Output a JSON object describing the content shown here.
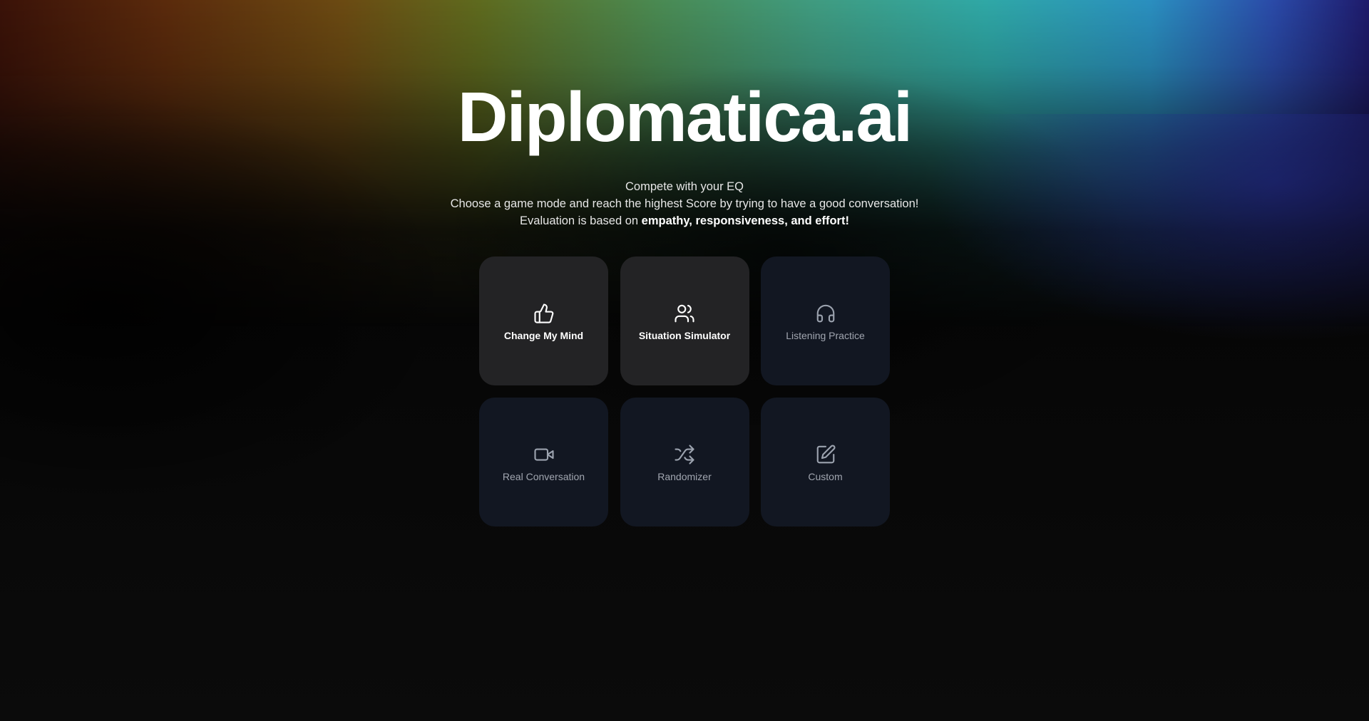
{
  "header": {
    "title": "Diplomatica.ai"
  },
  "intro": {
    "line1": "Compete with your EQ",
    "line2": "Choose a game mode and reach the highest Score by trying to have a good conversation!",
    "line3_prefix": "Evaluation is based on ",
    "line3_bold": "empathy, responsiveness, and effort!"
  },
  "modes": [
    {
      "label": "Change My Mind",
      "icon": "thumbs-up-icon",
      "state": "active"
    },
    {
      "label": "Situation Simulator",
      "icon": "users-icon",
      "state": "active"
    },
    {
      "label": "Listening Practice",
      "icon": "headphones-icon",
      "state": "inactive"
    },
    {
      "label": "Real Conversation",
      "icon": "video-icon",
      "state": "inactive"
    },
    {
      "label": "Randomizer",
      "icon": "shuffle-icon",
      "state": "inactive"
    },
    {
      "label": "Custom",
      "icon": "edit-icon",
      "state": "inactive"
    }
  ],
  "colors": {
    "background": "#050505",
    "card_active": "#232325",
    "card_inactive": "#121722",
    "text_primary": "#ffffff",
    "text_muted": "#a1a6b0"
  }
}
